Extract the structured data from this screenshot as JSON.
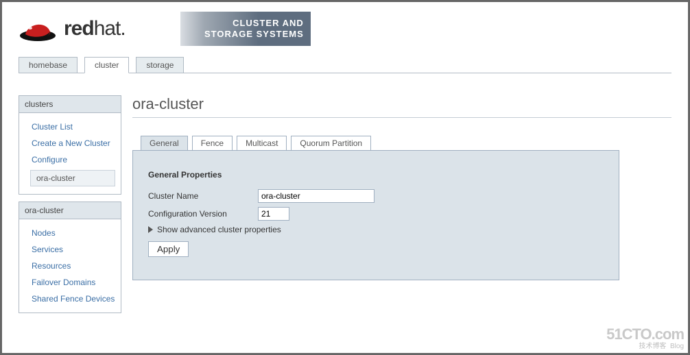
{
  "brand": {
    "part1": "red",
    "part2": "hat",
    "banner_line1": "CLUSTER AND",
    "banner_line2": "STORAGE SYSTEMS"
  },
  "topnav": {
    "items": [
      {
        "label": "homebase",
        "active": false
      },
      {
        "label": "cluster",
        "active": true
      },
      {
        "label": "storage",
        "active": false
      }
    ]
  },
  "sidebar": {
    "boxes": [
      {
        "title": "clusters",
        "items": [
          {
            "label": "Cluster List",
            "sub": false
          },
          {
            "label": "Create a New Cluster",
            "sub": false
          },
          {
            "label": "Configure",
            "sub": false
          },
          {
            "label": "ora-cluster",
            "sub": true
          }
        ]
      },
      {
        "title": "ora-cluster",
        "items": [
          {
            "label": "Nodes",
            "sub": false
          },
          {
            "label": "Services",
            "sub": false
          },
          {
            "label": "Resources",
            "sub": false
          },
          {
            "label": "Failover Domains",
            "sub": false
          },
          {
            "label": "Shared Fence Devices",
            "sub": false
          }
        ]
      }
    ]
  },
  "page": {
    "title": "ora-cluster"
  },
  "subtabs": [
    {
      "label": "General",
      "active": true
    },
    {
      "label": "Fence",
      "active": false
    },
    {
      "label": "Multicast",
      "active": false
    },
    {
      "label": "Quorum Partition",
      "active": false
    }
  ],
  "panel": {
    "heading": "General Properties",
    "fields": {
      "cluster_name": {
        "label": "Cluster Name",
        "value": "ora-cluster"
      },
      "config_version": {
        "label": "Configuration Version",
        "value": "21"
      }
    },
    "disclosure": "Show advanced cluster properties",
    "apply": "Apply"
  },
  "watermark": {
    "big": "51CTO.com",
    "small1": "技术博客",
    "small2": "Blog"
  }
}
